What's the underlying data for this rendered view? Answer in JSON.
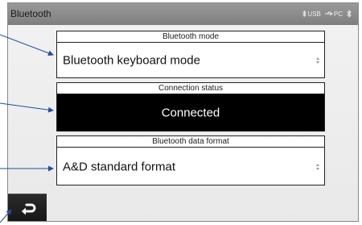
{
  "topbar": {
    "title": "Bluetooth",
    "status": [
      {
        "label": "USB",
        "icon": "bluetooth-small-icon"
      },
      {
        "label": "PC",
        "icon": "usb-plug-icon"
      },
      {
        "label": "",
        "icon": "bluetooth-icon"
      }
    ]
  },
  "panels": {
    "mode": {
      "header": "Bluetooth mode",
      "value": "Bluetooth keyboard mode"
    },
    "connection": {
      "header": "Connection status",
      "value": "Connected"
    },
    "format": {
      "header": "Bluetooth data format",
      "value": "A&D standard format"
    }
  },
  "colors": {
    "topbar": "#8a8a8a",
    "status_bg": "#000000",
    "callout": "#1f4fa0",
    "back_button": "#1e1e1e"
  },
  "icons": {
    "back": "return-arrow-icon",
    "stepper": "updown-icon"
  }
}
